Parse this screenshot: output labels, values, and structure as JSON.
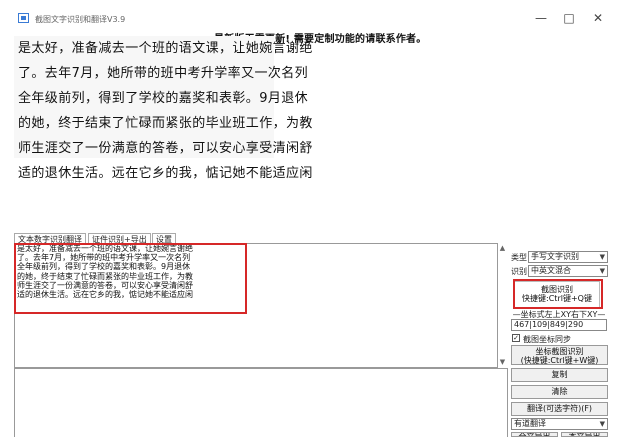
{
  "window": {
    "title": "截图文字识别和翻译V3.9",
    "notice": "最新版无需更新! 需要定制功能的请联系作者。",
    "minimize": "—",
    "maximize": "□",
    "close": "✕"
  },
  "preview": {
    "lines": [
      "是太好，准备减去一个班的语文课，让她婉言谢绝",
      "了。去年7月，她所带的班中考升学率又一次名列",
      "全年级前列，得到了学校的嘉奖和表彰。9月退休",
      "的她，终于结束了忙碌而紧张的毕业班工作，为教",
      "师生涯交了一份满意的答卷，可以安心享受清闲舒",
      "适的退休生活。远在它乡的我，惦记她不能适应闲"
    ]
  },
  "tabs": [
    "文本数字识别翻译",
    "证件识别+导出",
    "设置"
  ],
  "result": {
    "lines": [
      "是太好，准备减去一个班的语文课，让她婉言谢绝",
      "了。去年7月，她所带的班中考升学率又一次名列",
      "全年级前列，得到了学校的嘉奖和表彰。9月退休",
      "的她，终于结束了忙碌而紧张的毕业班工作，为教",
      "师生涯交了一份满意的答卷，可以安心享受清闲舒",
      "适的退休生活。远在它乡的我，惦记她不能适应闲"
    ]
  },
  "side": {
    "type_label": "类型",
    "type_value": "手写文字识别",
    "lang_label": "识别",
    "lang_value": "中英文混合",
    "capture_button_line1": "截图识别",
    "capture_button_line2": "快捷键:Ctrl键+Q键",
    "coord_label": "—坐标式左上XY右下XY—",
    "coord_value": "467|109|849|290",
    "sync_label": "截图坐标同步",
    "coord_capture_line1": "坐标截图识别",
    "coord_capture_line2": "(快捷键:Ctrl键+W键)",
    "copy_button": "复制",
    "clear_button": "清除",
    "translate_button": "翻译(可选字符)(F)",
    "translate_mode": "有道翻译",
    "bottom_button_1": "全文导出",
    "bottom_button_2": "本文导出"
  },
  "colors": {
    "highlight": "#d62828",
    "icon": "#3a7bd5"
  }
}
